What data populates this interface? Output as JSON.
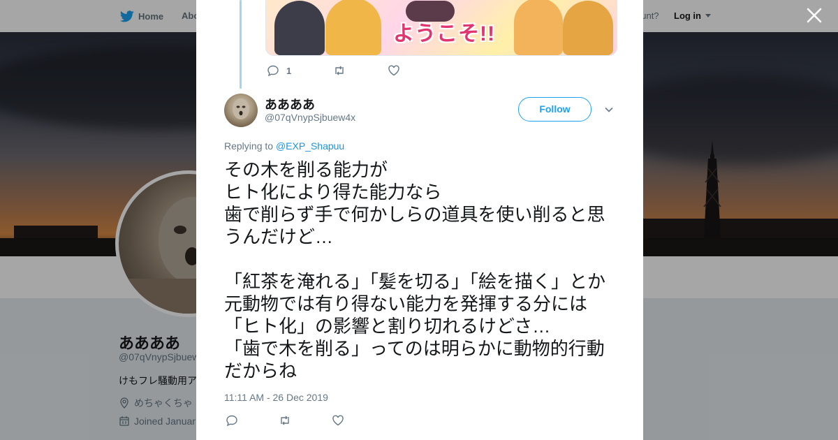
{
  "nav": {
    "home": "Home",
    "about": "Abo",
    "account_prompt": "ccount?",
    "login": "Log in"
  },
  "profile": {
    "name": "ああああ",
    "handle": "@07qVnypSjbuew",
    "bio": "けもフレ騒動用ア",
    "location": "めちゃくちゃ",
    "joined": "Joined Januar"
  },
  "modal": {
    "media_text": "ようこそ!!",
    "top_actions": {
      "reply_count": "1"
    },
    "author": {
      "name": "ああああ",
      "handle": "@07qVnypSjbuew4x"
    },
    "follow_label": "Follow",
    "replying_prefix": "Replying to",
    "replying_to": "@EXP_Shapuu",
    "text": "その木を削る能力が\nヒト化により得た能力なら\n歯で削らず手で何かしらの道具を使い削ると思うんだけど…\n\n「紅茶を淹れる」「髪を切る」「絵を描く」とか元動物では有り得ない能力を発揮する分には「ヒト化」の影響と割り切れるけどさ…\n「歯で木を削る」ってのは明らかに動物的行動だからね",
    "timestamp": "11:11 AM - 26 Dec 2019"
  },
  "colors": {
    "twitter_blue": "#1da1f2",
    "link_blue": "#1b95e0",
    "muted": "#657786",
    "text": "#14171a"
  },
  "icons": [
    "twitter-bird-icon",
    "close-icon",
    "reply-icon",
    "retweet-icon",
    "like-icon",
    "chevron-down-icon",
    "location-icon",
    "calendar-icon",
    "caret-down-icon"
  ]
}
